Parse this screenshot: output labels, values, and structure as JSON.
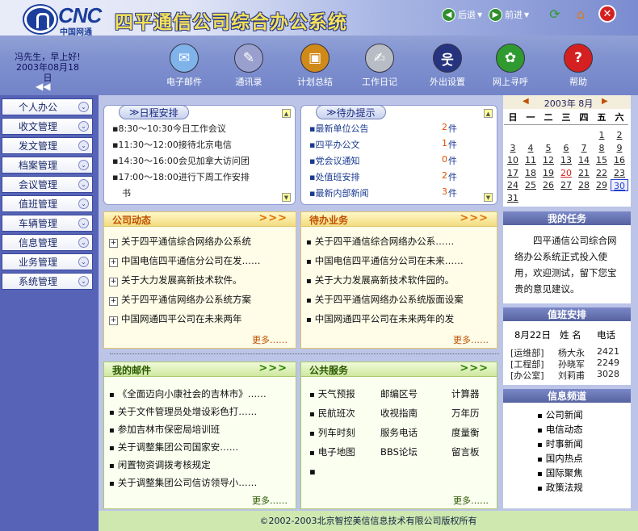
{
  "header": {
    "logo_text": "CNC",
    "logo_cn": "中国网通",
    "title": "四平通信公司综合办公系统",
    "back": "后退",
    "forward": "前进",
    "greeting_line1": "冯先生，早上好!",
    "greeting_line2": "2003年08月18日",
    "collapse": "◀◀"
  },
  "toolbar": [
    {
      "label": "电子邮件",
      "icon": "mail-icon",
      "glyph": "✉",
      "color": "#7fb3ea"
    },
    {
      "label": "通讯录",
      "icon": "address-book-icon",
      "glyph": "✎",
      "color": "#9aa0ce"
    },
    {
      "label": "计划总结",
      "icon": "briefcase-icon",
      "glyph": "▣",
      "color": "#d08a1a"
    },
    {
      "label": "工作日记",
      "icon": "diary-icon",
      "glyph": "✍",
      "color": "#b8bcc4"
    },
    {
      "label": "外出设置",
      "icon": "running-man-icon",
      "glyph": "웃",
      "color": "#263480"
    },
    {
      "label": "网上寻呼",
      "icon": "flower-icon",
      "glyph": "✿",
      "color": "#2f9a2f"
    },
    {
      "label": "帮助",
      "icon": "help-icon",
      "glyph": "?",
      "color": "#d42020"
    }
  ],
  "sidebar": [
    "个人办公",
    "收文管理",
    "发文管理",
    "档案管理",
    "会议管理",
    "值班管理",
    "车辆管理",
    "信息管理",
    "业务管理",
    "系统管理"
  ],
  "schedule": {
    "title": "日程安排",
    "items": [
      "8:30～10:30今日工作会议",
      "11:30～12:00接待北京电信",
      "14:30～16:00会见加拿大访问团",
      "17:00～18:00进行下周工作安排",
      "书"
    ]
  },
  "pending": {
    "title": "待办提示",
    "items": [
      {
        "label": "最新单位公告",
        "count": "2",
        "unit": "件"
      },
      {
        "label": "四平办公文",
        "count": "1",
        "unit": "件"
      },
      {
        "label": "党会议通知",
        "count": "0",
        "unit": "件"
      },
      {
        "label": "处值班安排",
        "count": "2",
        "unit": "件"
      },
      {
        "label": "最新内部新闻",
        "count": "3",
        "unit": "件"
      }
    ]
  },
  "calendar": {
    "title": "2003年 8月",
    "weekdays": [
      "日",
      "一",
      "二",
      "三",
      "四",
      "五",
      "六"
    ],
    "days": [
      "",
      "",
      "",
      "",
      "",
      "1",
      "2",
      "3",
      "4",
      "5",
      "6",
      "7",
      "8",
      "9",
      "10",
      "11",
      "12",
      "13",
      "14",
      "15",
      "16",
      "17",
      "18",
      "19",
      "20",
      "21",
      "22",
      "23",
      "24",
      "25",
      "26",
      "27",
      "28",
      "29",
      "30",
      "31"
    ],
    "today": "20",
    "selected": "30"
  },
  "company_news": {
    "title": "公司动态",
    "arrows": ">>>",
    "items": [
      "关于四平通信综合网络办公系统",
      "中国电信四平通信分公司在发……",
      "关于大力发展高新技术软件。",
      "关于四平通信网络办公系统方案",
      "中国网通四平公司在未来两年"
    ],
    "more": "更多……"
  },
  "pending_work": {
    "title": "待办业务",
    "arrows": ">>>",
    "items": [
      "关于四平通信综合网络办公系……",
      "中国电信四平通信分公司在未来……",
      "关于大力发展高新技术软件园的。",
      "关于四平通信网络办公系统版面设案",
      "中国网通四平公司在未来两年的发"
    ],
    "more": "更多……"
  },
  "my_mail": {
    "title": "我的邮件",
    "arrows": ">>>",
    "items": [
      "《全面迈向小康社会的吉林市》……",
      "关于文件管理员处增设彩色打……",
      "参加吉林市保密局培训班",
      "关于调整集团公司国家安……",
      "闲置物资调拨考核规定",
      "关于调整集团公司信访领导小……"
    ],
    "more": "更多……"
  },
  "public_service": {
    "title": "公共服务",
    "arrows": ">>>",
    "rows": [
      [
        "天气预报",
        "邮编区号",
        "计算器"
      ],
      [
        "民航班次",
        "收视指南",
        "万年历"
      ],
      [
        "列车时刻",
        "服务电话",
        "度量衡"
      ],
      [
        "电子地图",
        "BBS论坛",
        "留言板"
      ],
      [
        "",
        "",
        " "
      ]
    ],
    "more": "更多……"
  },
  "my_tasks": {
    "title": "我的任务",
    "text": "四平通信公司综合网络办公系统正式投入使用，欢迎测试，留下您宝贵的意见建议。"
  },
  "duty": {
    "title": "值班安排",
    "header": [
      "8月22日",
      "姓 名",
      "电话"
    ],
    "rows": [
      [
        "[运维部]",
        "杨大永",
        "2421"
      ],
      [
        "[工程部]",
        "孙晓军",
        "2249"
      ],
      [
        "[办公室]",
        "刘莉甫",
        "3028"
      ]
    ]
  },
  "info": {
    "title": "信息频道",
    "items": [
      "公司新闻",
      "电信动态",
      "时事新闻",
      "国内热点",
      "国际聚焦",
      "政策法规"
    ]
  },
  "footer": "©2002-2003北京智控美信信息技术有限公司版权所有"
}
